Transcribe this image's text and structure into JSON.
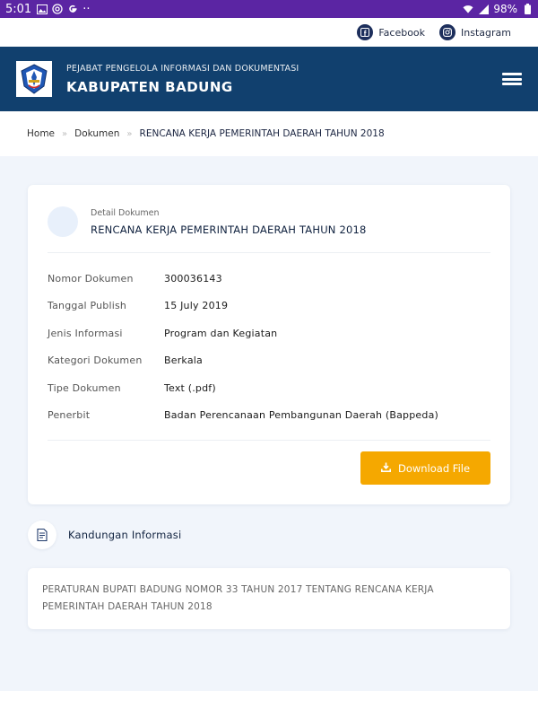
{
  "status_bar": {
    "time": "5:01",
    "dots": "··",
    "battery": "98%"
  },
  "social": {
    "facebook": "Facebook",
    "instagram": "Instagram"
  },
  "header": {
    "subtitle": "PEJABAT PENGELOLA INFORMASI DAN DOKUMENTASI",
    "title": "KABUPATEN BADUNG"
  },
  "breadcrumb": {
    "home": "Home",
    "sep": "»",
    "docs": "Dokumen",
    "current": "RENCANA KERJA PEMERINTAH DAERAH TAHUN 2018"
  },
  "detail": {
    "label": "Detail Dokumen",
    "title": "RENCANA KERJA PEMERINTAH DAERAH TAHUN 2018",
    "rows": [
      {
        "key": "Nomor Dokumen",
        "value": "300036143"
      },
      {
        "key": "Tanggal Publish",
        "value": "15 July 2019"
      },
      {
        "key": "Jenis Informasi",
        "value": "Program dan Kegiatan"
      },
      {
        "key": "Kategori Dokumen",
        "value": "Berkala"
      },
      {
        "key": "Tipe Dokumen",
        "value": "Text (.pdf)"
      },
      {
        "key": "Penerbit",
        "value": "Badan Perencanaan Pembangunan Daerah (Bappeda)"
      }
    ],
    "download_label": "Download File"
  },
  "content_section": {
    "title": "Kandungan Informasi",
    "text": "PERATURAN BUPATI BADUNG NOMOR 33 TAHUN 2017 TENTANG RENCANA KERJA PEMERINTAH DAERAH TAHUN 2018"
  },
  "colors": {
    "status_bar": "#5b25a3",
    "header": "#11406e",
    "accent": "#f5a800",
    "background": "#f1f5fb"
  }
}
